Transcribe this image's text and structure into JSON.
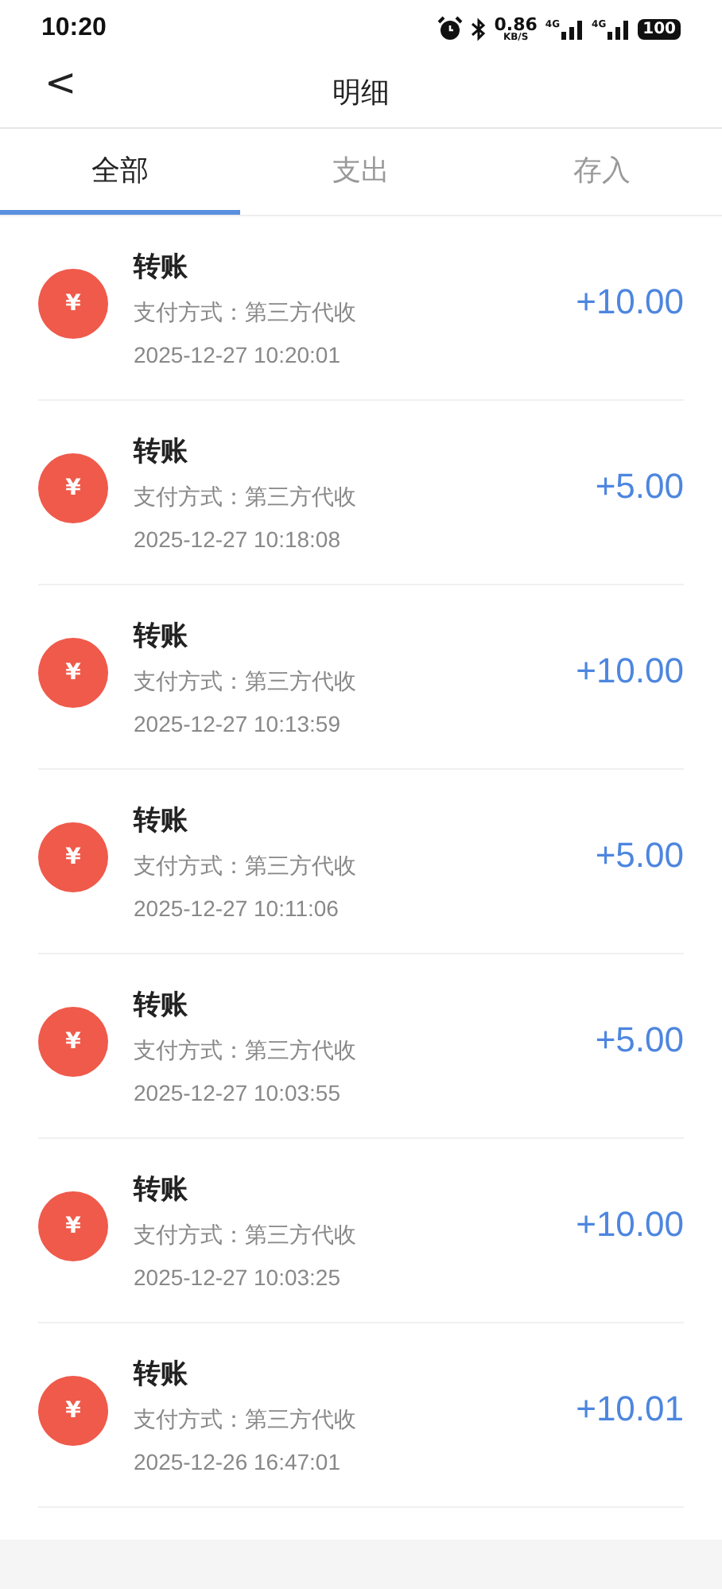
{
  "status_bar": {
    "time": "10:20",
    "net_speed": "0.86",
    "net_unit": "KB/S",
    "signals": [
      "4G",
      "4G"
    ],
    "battery": "100"
  },
  "header": {
    "back": "<",
    "title": "明细"
  },
  "tabs": [
    {
      "label": "全部",
      "selected": true
    },
    {
      "label": "支出",
      "selected": false
    },
    {
      "label": "存入",
      "selected": false
    }
  ],
  "records": [
    {
      "icon": "¥",
      "title": "转账",
      "method": "支付方式：第三方代收",
      "time": "2025-12-27 10:20:01",
      "amount": "+10.00"
    },
    {
      "icon": "¥",
      "title": "转账",
      "method": "支付方式：第三方代收",
      "time": "2025-12-27 10:18:08",
      "amount": "+5.00"
    },
    {
      "icon": "¥",
      "title": "转账",
      "method": "支付方式：第三方代收",
      "time": "2025-12-27 10:13:59",
      "amount": "+10.00"
    },
    {
      "icon": "¥",
      "title": "转账",
      "method": "支付方式：第三方代收",
      "time": "2025-12-27 10:11:06",
      "amount": "+5.00"
    },
    {
      "icon": "¥",
      "title": "转账",
      "method": "支付方式：第三方代收",
      "time": "2025-12-27 10:03:55",
      "amount": "+5.00"
    },
    {
      "icon": "¥",
      "title": "转账",
      "method": "支付方式：第三方代收",
      "time": "2025-12-27 10:03:25",
      "amount": "+10.00"
    },
    {
      "icon": "¥",
      "title": "转账",
      "method": "支付方式：第三方代收",
      "time": "2025-12-26 16:47:01",
      "amount": "+10.01"
    }
  ]
}
